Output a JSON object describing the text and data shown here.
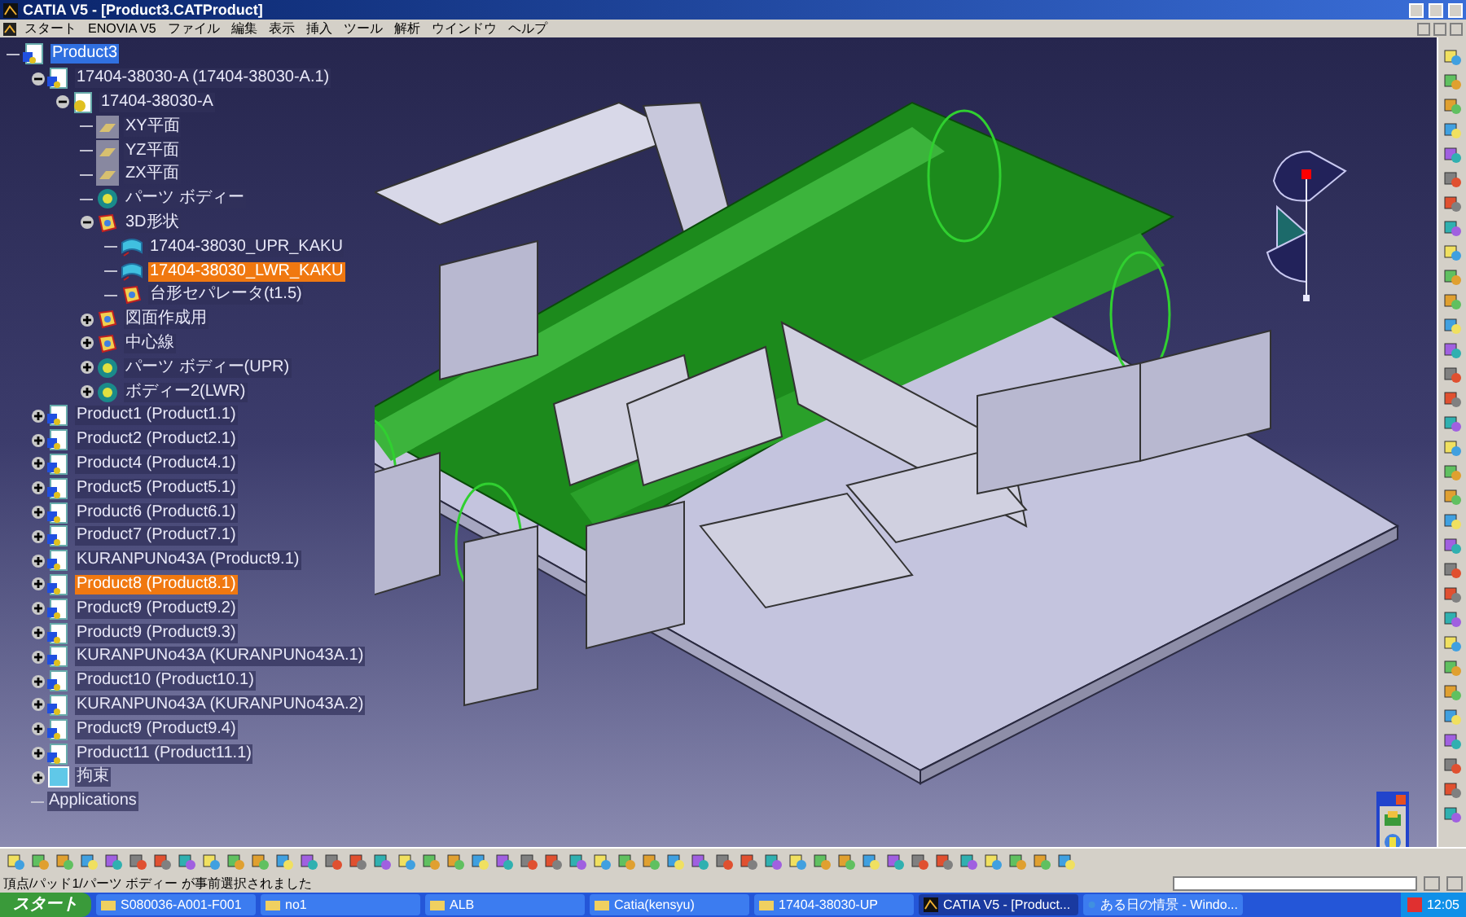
{
  "window": {
    "title": "CATIA V5 - [Product3.CATProduct]"
  },
  "menu": [
    "スタート",
    "ENOVIA V5",
    "ファイル",
    "編集",
    "表示",
    "挿入",
    "ツール",
    "解析",
    "ウインドウ",
    "ヘルプ"
  ],
  "tree": [
    {
      "label": "Product3",
      "kind": "product",
      "active": true,
      "selected": false,
      "children": [
        {
          "label": "17404-38030-A (17404-38030-A.1)",
          "kind": "product",
          "expanded": true,
          "selected": false,
          "children": [
            {
              "label": "17404-38030-A",
              "kind": "part",
              "expanded": true,
              "selected": false,
              "children": [
                {
                  "label": "XY平面",
                  "kind": "plane",
                  "selected": false
                },
                {
                  "label": "YZ平面",
                  "kind": "plane",
                  "selected": false
                },
                {
                  "label": "ZX平面",
                  "kind": "plane",
                  "selected": false
                },
                {
                  "label": "パーツ ボディー",
                  "kind": "body",
                  "selected": false
                },
                {
                  "label": "3D形状",
                  "kind": "geoset",
                  "expanded": true,
                  "selected": false,
                  "children": [
                    {
                      "label": "17404-38030_UPR_KAKU",
                      "kind": "surface",
                      "selected": false
                    },
                    {
                      "label": "17404-38030_LWR_KAKU",
                      "kind": "surface",
                      "selected": true
                    },
                    {
                      "label": "台形セパレータ(t1.5)",
                      "kind": "geoset",
                      "selected": false
                    }
                  ]
                },
                {
                  "label": "図面作成用",
                  "kind": "geoset",
                  "expanded": false,
                  "selected": false
                },
                {
                  "label": "中心線",
                  "kind": "geoset",
                  "expanded": false,
                  "selected": false
                },
                {
                  "label": "パーツ ボディー(UPR)",
                  "kind": "body",
                  "expanded": false,
                  "selected": false
                },
                {
                  "label": "ボディー2(LWR)",
                  "kind": "body",
                  "expanded": false,
                  "selected": false
                }
              ]
            }
          ]
        },
        {
          "label": "Product1 (Product1.1)",
          "kind": "product",
          "expanded": false,
          "selected": false
        },
        {
          "label": "Product2 (Product2.1)",
          "kind": "product",
          "expanded": false,
          "selected": false
        },
        {
          "label": "Product4 (Product4.1)",
          "kind": "product",
          "expanded": false,
          "selected": false
        },
        {
          "label": "Product5 (Product5.1)",
          "kind": "product",
          "expanded": false,
          "selected": false
        },
        {
          "label": "Product6 (Product6.1)",
          "kind": "product",
          "expanded": false,
          "selected": false
        },
        {
          "label": "Product7 (Product7.1)",
          "kind": "product",
          "expanded": false,
          "selected": false
        },
        {
          "label": "KURANPUNo43A (Product9.1)",
          "kind": "product",
          "expanded": false,
          "selected": false
        },
        {
          "label": "Product8 (Product8.1)",
          "kind": "product",
          "expanded": false,
          "selected": true
        },
        {
          "label": "Product9 (Product9.2)",
          "kind": "product",
          "expanded": false,
          "selected": false
        },
        {
          "label": "Product9 (Product9.3)",
          "kind": "product",
          "expanded": false,
          "selected": false
        },
        {
          "label": "KURANPUNo43A (KURANPUNo43A.1)",
          "kind": "product",
          "expanded": false,
          "selected": false
        },
        {
          "label": "Product10 (Product10.1)",
          "kind": "product",
          "expanded": false,
          "selected": false
        },
        {
          "label": "KURANPUNo43A (KURANPUNo43A.2)",
          "kind": "product",
          "expanded": false,
          "selected": false
        },
        {
          "label": "Product9 (Product9.4)",
          "kind": "product",
          "expanded": false,
          "selected": false
        },
        {
          "label": "Product11 (Product11.1)",
          "kind": "product",
          "expanded": false,
          "selected": false
        },
        {
          "label": "拘束",
          "kind": "constraint",
          "expanded": false,
          "selected": false
        },
        {
          "label": "Applications",
          "kind": "applications",
          "selected": false
        }
      ]
    }
  ],
  "status_bar": {
    "message": "頂点/パッド1/パーツ ボディー が事前選択されました"
  },
  "taskbar": {
    "start": "スタート",
    "buttons": [
      {
        "label": "S080036-A001-F001",
        "kind": "folder",
        "selected": false
      },
      {
        "label": "no1",
        "kind": "folder",
        "selected": false
      },
      {
        "label": "ALB",
        "kind": "folder",
        "selected": false
      },
      {
        "label": "Catia(kensyu)",
        "kind": "folder",
        "selected": false
      },
      {
        "label": "17404-38030-UP",
        "kind": "folder",
        "selected": false
      },
      {
        "label": "CATIA V5 - [Product...",
        "kind": "app",
        "selected": true
      },
      {
        "label": "ある日の情景 - Windo...",
        "kind": "browser",
        "selected": false
      }
    ],
    "clock": "12:05"
  }
}
